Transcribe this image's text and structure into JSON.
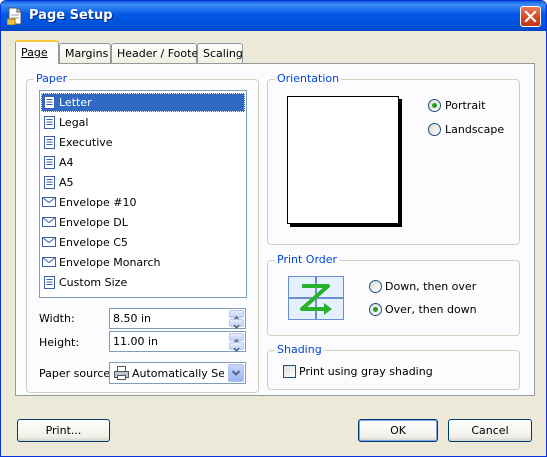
{
  "window": {
    "title": "Page Setup"
  },
  "tabs": [
    {
      "label": "Page",
      "active": true
    },
    {
      "label": "Margins",
      "active": false
    },
    {
      "label": "Header / Footer",
      "active": false
    },
    {
      "label": "Scaling",
      "active": false
    }
  ],
  "paper": {
    "group_label": "Paper",
    "sizes": [
      {
        "label": "Letter",
        "icon": "page-icon",
        "selected": true
      },
      {
        "label": "Legal",
        "icon": "page-icon"
      },
      {
        "label": "Executive",
        "icon": "page-icon"
      },
      {
        "label": "A4",
        "icon": "page-icon"
      },
      {
        "label": "A5",
        "icon": "page-icon"
      },
      {
        "label": "Envelope #10",
        "icon": "envelope-icon"
      },
      {
        "label": "Envelope DL",
        "icon": "envelope-icon"
      },
      {
        "label": "Envelope C5",
        "icon": "envelope-icon"
      },
      {
        "label": "Envelope Monarch",
        "icon": "envelope-icon"
      },
      {
        "label": "Custom Size",
        "icon": "page-icon"
      }
    ],
    "width_label": "Width:",
    "width_value": "8.50 in",
    "height_label": "Height:",
    "height_value": "11.00 in",
    "source_label": "Paper source:",
    "source_value": "Automatically Select"
  },
  "orientation": {
    "group_label": "Orientation",
    "portrait_label": "Portrait",
    "landscape_label": "Landscape",
    "selected": "portrait"
  },
  "print_order": {
    "group_label": "Print Order",
    "down_over_label": "Down, then over",
    "over_down_label": "Over, then down",
    "selected": "over_down"
  },
  "shading": {
    "group_label": "Shading",
    "gray_label": "Print using gray shading",
    "checked": false
  },
  "buttons": {
    "print": "Print...",
    "ok": "OK",
    "cancel": "Cancel"
  },
  "colors": {
    "titlebar": "#0058e6",
    "group_label": "#0046d5",
    "selection": "#316ac5",
    "radio_dot": "#21a121",
    "arrow": "#2ab12a"
  }
}
